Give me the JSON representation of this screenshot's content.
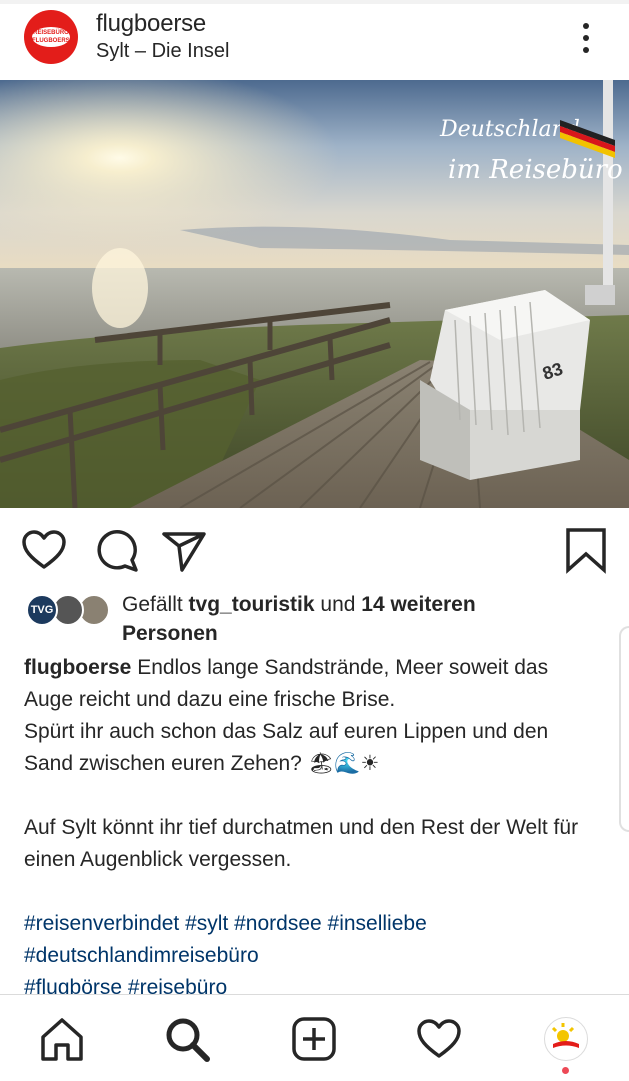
{
  "post": {
    "username": "flugboerse",
    "location": "Sylt – Die Insel",
    "avatar_text": "REISEBÜRO FLUGBOERSE",
    "photo_overlay_line1": "Deutschland",
    "photo_overlay_line2": "im Reisebüro",
    "chair_number": "83"
  },
  "likes": {
    "prefix": "Gefällt ",
    "user": "tvg_touristik",
    "mid": " und ",
    "count": "14 weiteren Personen",
    "tvg_badge": "TVG"
  },
  "caption": {
    "author": "flugboerse",
    "line1": " Endlos lange Sandstrände, Meer soweit das Auge reicht und dazu eine frische Brise.",
    "line2": "Spürt ihr auch schon das Salz auf euren Lippen und den Sand zwischen euren Zehen? ",
    "emojis": "🏖🌊☀",
    "line3": "Auf Sylt könnt ihr tief durchatmen und den Rest der Welt für einen Augenblick vergessen."
  },
  "hashtags": {
    "line1": "#reisenverbindet #sylt #nordsee  #inselliebe",
    "line2": "#deutschlandimreisebüro",
    "line3": "#flugbörse #reisebüro"
  },
  "icons": [
    "more-vertical-icon",
    "heart-icon",
    "comment-icon",
    "share-icon",
    "bookmark-icon",
    "home-icon",
    "search-icon",
    "add-icon",
    "activity-icon",
    "profile-icon"
  ],
  "colors": {
    "brand_red": "#e31d1a",
    "hashtag": "#003569",
    "notification_dot": "#ed4956"
  }
}
